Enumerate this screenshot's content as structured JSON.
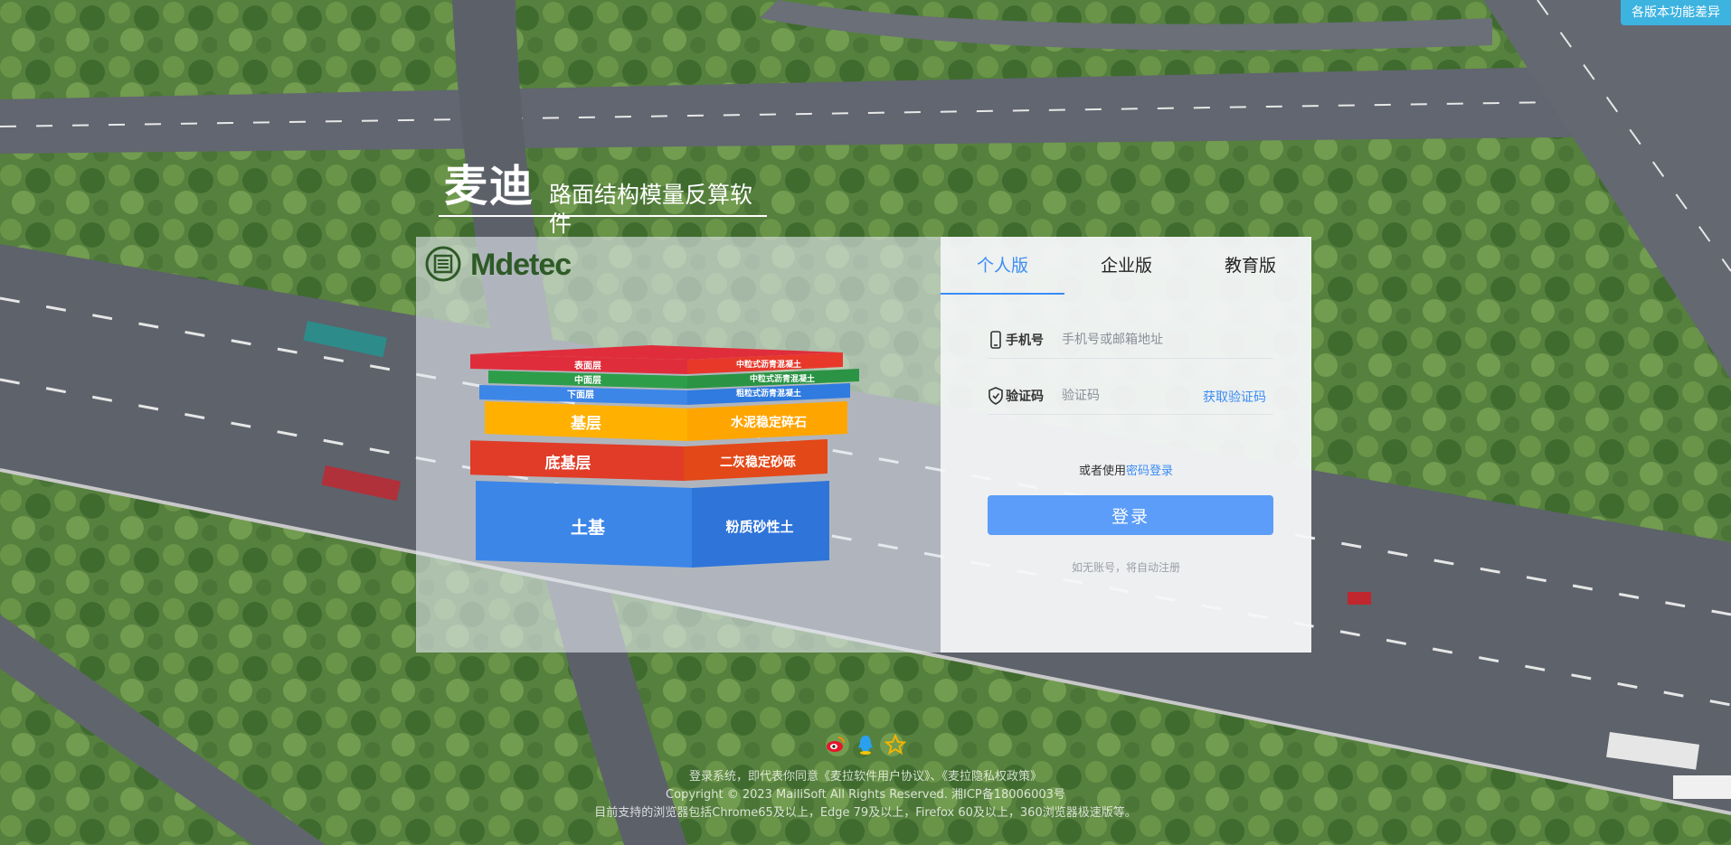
{
  "top_badge": "各版本功能差异",
  "brand": {
    "name": "麦迪",
    "tagline": "路面结构模量反算软件"
  },
  "logo": {
    "text": "Mdetec",
    "icon": "road-logo-icon"
  },
  "layers": {
    "labels_left": [
      "表面层",
      "中面层",
      "下面层",
      "基层",
      "底基层",
      "土基"
    ],
    "labels_right": [
      "中粒式沥青混凝土",
      "中粒式沥青混凝土",
      "粗粒式沥青混凝土",
      "水泥稳定碎石",
      "二灰稳定砂砾",
      "粉质砂性土"
    ],
    "colors": [
      "#e02d3b",
      "#2e9d4a",
      "#3c86e8",
      "#ffb000",
      "#e03c28",
      "#3c86e8"
    ]
  },
  "tabs": [
    {
      "label": "个人版",
      "active": true
    },
    {
      "label": "企业版",
      "active": false
    },
    {
      "label": "教育版",
      "active": false
    }
  ],
  "form": {
    "phone_label": "手机号",
    "phone_placeholder": "手机号或邮箱地址",
    "code_label": "验证码",
    "code_placeholder": "验证码",
    "get_code": "获取验证码",
    "alt_prefix": "或者使用",
    "alt_link": "密码登录",
    "login_button": "登录",
    "hint": "如无账号，将自动注册"
  },
  "social_icons": [
    "weibo-icon",
    "qq-icon",
    "star-icon"
  ],
  "footer": {
    "line1": "登录系统，即代表你同意《麦拉软件用户协议》、《麦拉隐私权政策》",
    "line2": "Copyright © 2023  MailiSoft All Rights Reserved. 湘ICP备18006003号",
    "line3": "目前支持的浏览器包括Chrome65及以上，Edge 79及以上，Firefox 60及以上，360浏览器极速版等。"
  },
  "colors": {
    "accent": "#3b8cf5",
    "badge": "#3db3e0",
    "button": "#5b9df8"
  }
}
